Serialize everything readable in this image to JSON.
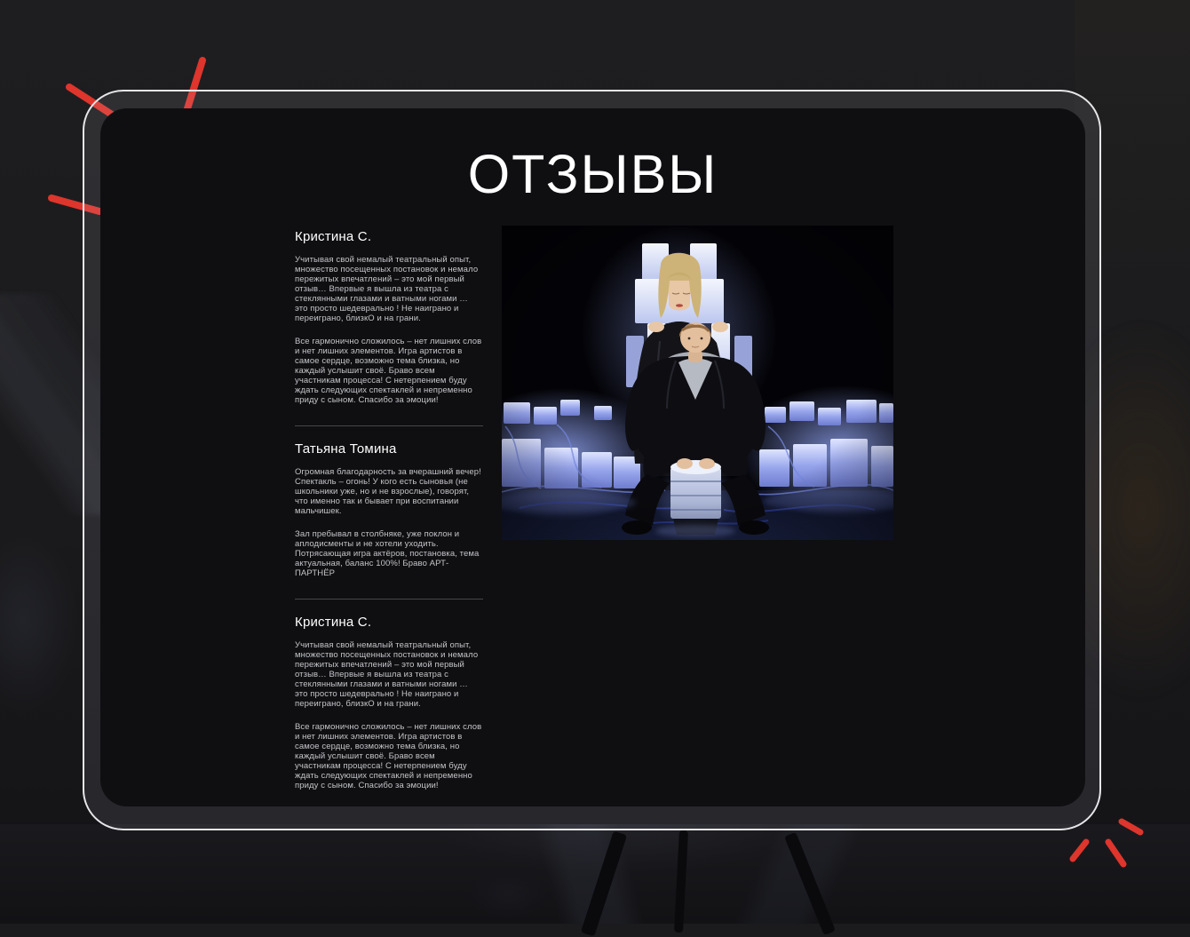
{
  "page": {
    "title": "ОТЗЫВЫ"
  },
  "reviews": [
    {
      "name": "Кристина С.",
      "paragraphs": [
        "Учитывая свой немалый театральный опыт, множество посещенных постановок и немало пережитых впечатлений – это мой первый отзыв… Впервые я вышла из театра с стеклянными глазами и ватными ногами … это просто шедеврально ! Не наиграно и переиграно, близкО и на грани.",
        "Все гармонично сложилось – нет лишних слов и нет лишних элементов. Игра артистов в самое сердце, возможно тема близка, но каждый услышит своё. Браво всем участникам процесса! С нетерпением буду ждать следующих спектаклей и непременно приду с сыном. Спасибо за эмоции!"
      ]
    },
    {
      "name": "Татьяна Томина",
      "paragraphs": [
        "Огромная благодарность за вчерашний вечер! Спектакль – огонь! У кого есть сыновья (не школьники уже, но и не взрослые), говорят, что именно так и бывает при воспитании мальчишек.",
        "Зал пребывал в столбняке, уже поклон и аплодисменты и не хотели уходить. Потрясающая игра актёров, постановка, тема актуальная, баланс 100%! Браво АРТ-ПАРТНЁР"
      ]
    },
    {
      "name": "Кристина С.",
      "paragraphs": [
        "Учитывая свой немалый театральный опыт, множество посещенных постановок и немало пережитых впечатлений – это мой первый отзыв… Впервые я вышла из театра с стеклянными глазами и ватными ногами … это просто шедеврально ! Не наиграно и переиграно, близкО и на грани.",
        "Все гармонично сложилось – нет лишних слов и нет лишних элементов. Игра артистов в самое сердце, возможно тема близка, но каждый услышит своё. Браво всем участникам процесса! С нетерпением буду ждать следующих спектаклей и непременно приду с сыном. Спасибо за эмоции!"
      ]
    }
  ],
  "colors": {
    "accent_red": "#de352c",
    "panel_bg": "#0f0f12",
    "frame_stroke": "#e7e7ea",
    "glow_blue": "#8fa2f0",
    "body_text": "#c4c5c8",
    "divider": "#515155"
  }
}
